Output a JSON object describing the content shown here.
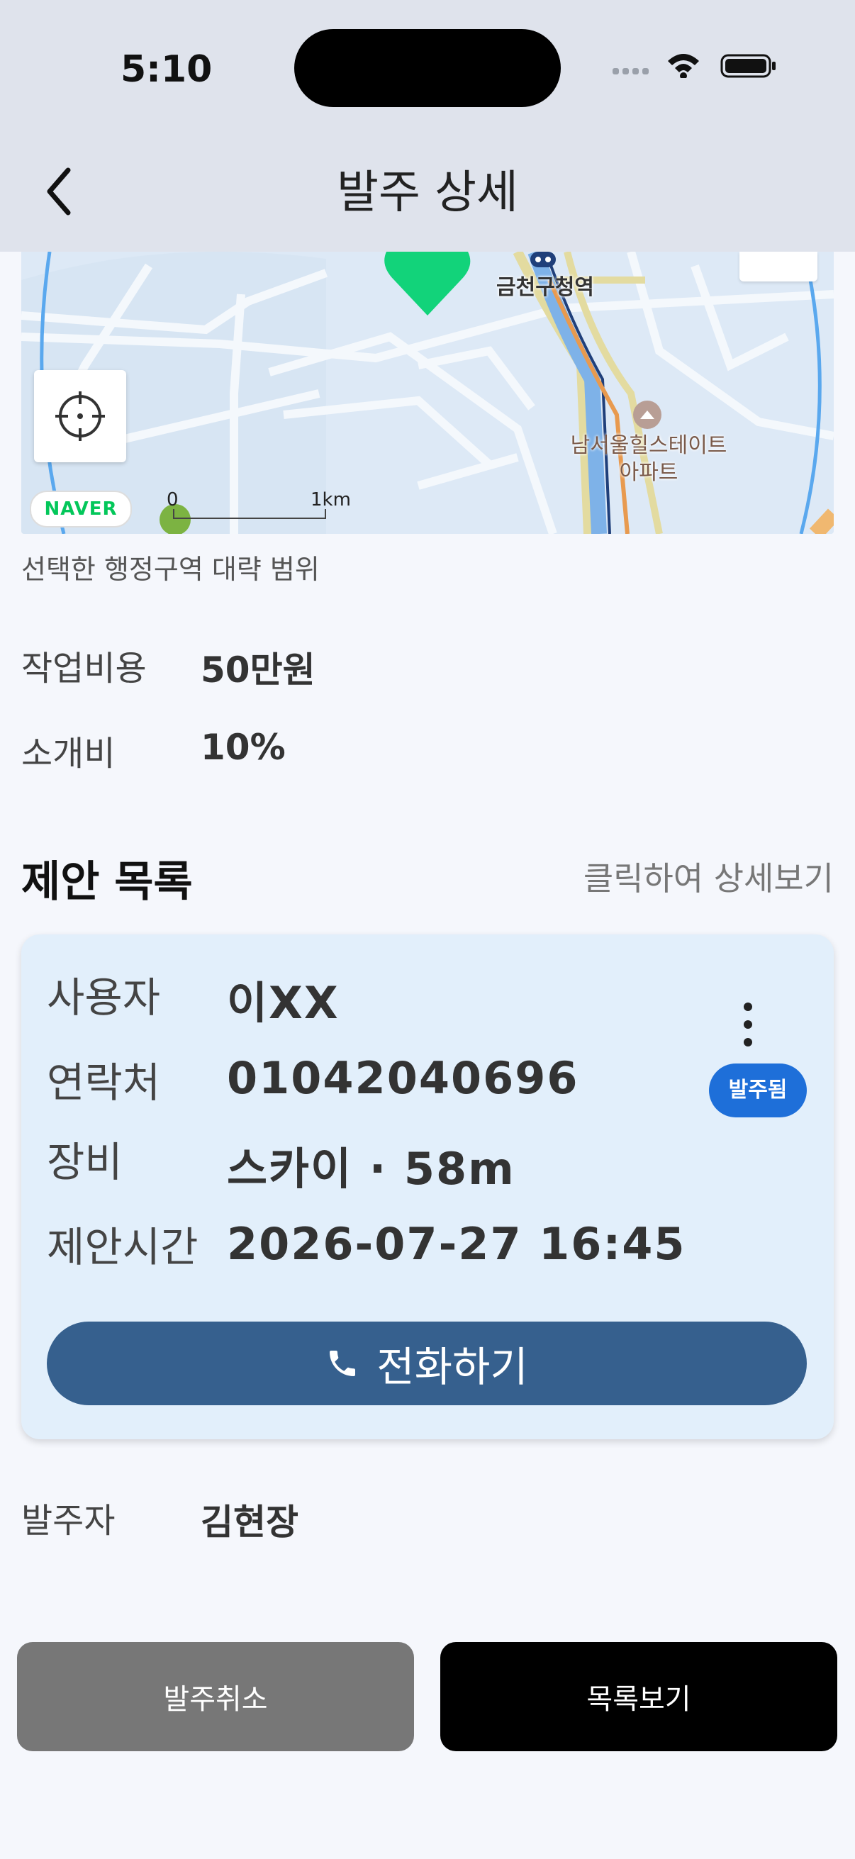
{
  "status_bar": {
    "time": "5:10"
  },
  "nav": {
    "title": "발주 상세"
  },
  "map": {
    "poi_station": "금천구청역",
    "poi_apartment_line1": "남서울힐스테이트",
    "poi_apartment_line2": "아파트",
    "logo": "NAVER",
    "scale_start": "0",
    "scale_end": "1km",
    "caption": "선택한 행정구역 대략 범위"
  },
  "details": {
    "cost_label": "작업비용",
    "cost_value": "50만원",
    "fee_label": "소개비",
    "fee_value": "10%"
  },
  "proposals": {
    "title": "제안 목록",
    "hint": "클릭하여 상세보기",
    "items": [
      {
        "user_label": "사용자",
        "user_value": "이XX",
        "contact_label": "연락처",
        "contact_value": "01042040696",
        "equipment_label": "장비",
        "equipment_value": "스카이 · 58m",
        "time_label": "제안시간",
        "time_value": "2026-07-27 16:45",
        "status_badge": "발주됨",
        "call_label": "전화하기"
      }
    ]
  },
  "orderer": {
    "label": "발주자",
    "value": "김현장"
  },
  "actions": {
    "cancel_label": "발주취소",
    "list_label": "목록보기"
  },
  "colors": {
    "accent_blue": "#1E6FD9",
    "call_button": "#36608E",
    "card_bg": "#E2EFFB",
    "marker_green": "#12D37A"
  }
}
